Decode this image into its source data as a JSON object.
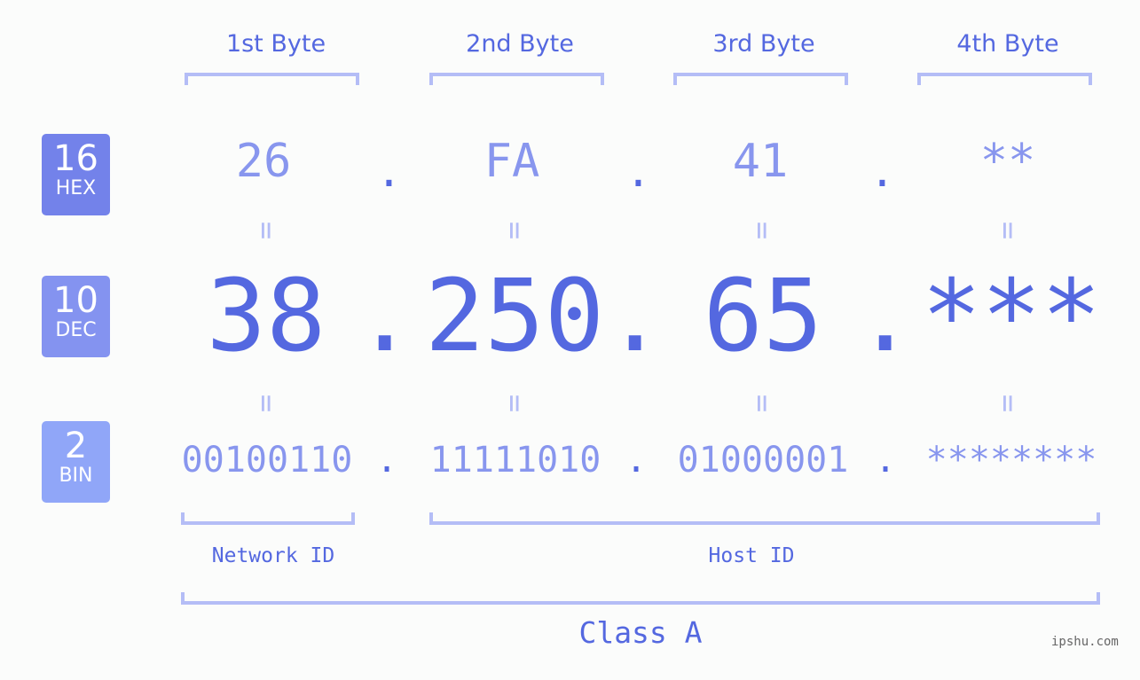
{
  "bases": [
    {
      "num": "16",
      "label": "HEX",
      "color": "#7382ea"
    },
    {
      "num": "10",
      "label": "DEC",
      "color": "#8493f0"
    },
    {
      "num": "2",
      "label": "BIN",
      "color": "#90a6f8"
    }
  ],
  "byte_headers": [
    "1st Byte",
    "2nd Byte",
    "3rd Byte",
    "4th Byte"
  ],
  "hex": [
    "26",
    "FA",
    "41",
    "**"
  ],
  "dec": [
    "38",
    "250",
    "65",
    "***"
  ],
  "bin": [
    "00100110",
    "11111010",
    "01000001",
    "********"
  ],
  "separator": ".",
  "equals": "=",
  "network_id_label": "Network ID",
  "host_id_label": "Host ID",
  "class_label": "Class A",
  "watermark": "ipshu.com"
}
